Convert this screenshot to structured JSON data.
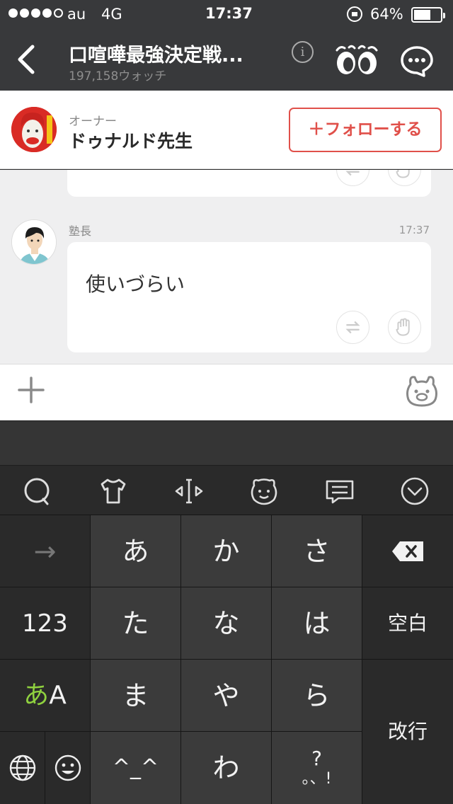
{
  "status_bar": {
    "carrier": "au",
    "network": "4G",
    "time": "17:37",
    "battery_text": "64%",
    "battery_level": 0.64,
    "signal_bars": 4,
    "signal_max": 5
  },
  "nav": {
    "title": "口喧嘩最強決定戦...",
    "watch_count": "197,158ウォッチ",
    "info_label": "i"
  },
  "owner": {
    "role": "オーナー",
    "name": "ドゥナルド先生",
    "follow_button": "＋フォローする"
  },
  "message": {
    "user": "塾長",
    "time": "17:37",
    "text": "使いづらい"
  },
  "keyboard": {
    "keys": {
      "arrow": "→",
      "a": "あ",
      "ka": "か",
      "sa": "さ",
      "backspace": "⌫",
      "numbers": "123",
      "ta": "た",
      "na": "な",
      "ha": "は",
      "space": "空白",
      "mode_a": "あ",
      "mode_A": "A",
      "ma": "ま",
      "ya": "や",
      "ra": "ら",
      "enter": "改行",
      "kaomoji": "^_^",
      "wa": "わ",
      "punct_top": "?",
      "punct_bottom": "。、!"
    }
  },
  "colors": {
    "nav_bg": "#38393b",
    "accent_red": "#e0504a",
    "chat_bg": "#efeff0",
    "mode_green": "#8fd13f"
  }
}
